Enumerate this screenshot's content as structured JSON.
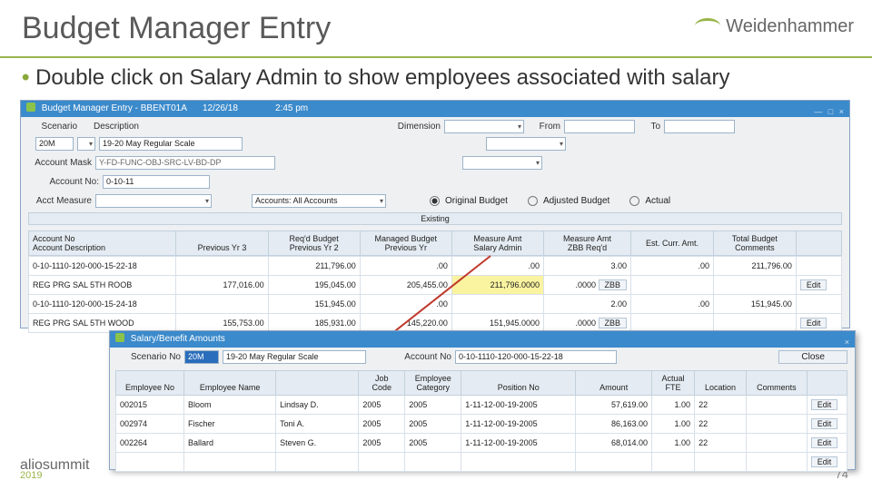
{
  "slide": {
    "title": "Budget Manager Entry",
    "bullet": "Double click on Salary Admin to show employees associated with salary",
    "brand": "Weidenhammer",
    "footer_logo": "aliosummit",
    "footer_year": "2019",
    "page_num": "74"
  },
  "win1": {
    "title": "Budget Manager Entry - BBENT01A",
    "date": "12/26/18",
    "time": "2:45 pm",
    "labels": {
      "scenario": "Scenario",
      "description": "Description",
      "dimension": "Dimension",
      "from": "From",
      "to": "To",
      "acct_mask": "Account Mask",
      "acct_no": "Account No:",
      "acct_measure": "Acct Measure"
    },
    "values": {
      "scenario": "20M",
      "description": "19-20 May Regular Scale",
      "acct_mask": "Y-FD-FUNC-OBJ-SRC-LV-BD-DP",
      "acct_no": "0-10-11"
    },
    "accounts_filter": "Accounts: All Accounts",
    "radios": {
      "orig": "Original Budget",
      "adj": "Adjusted Budget",
      "act": "Actual"
    },
    "existing_header": "Existing",
    "cols": {
      "acct_no": "Account No",
      "acct_desc": "Account Description",
      "py3": "Previous Yr 3",
      "reqd": "Req'd Budget",
      "py2": "Previous Yr 2",
      "managed": "Managed Budget",
      "py": "Previous Yr",
      "meas_amt_top": "Measure Amt",
      "sal_admin": "Salary Admin",
      "meas_amt2": "Measure Amt",
      "zbb": "ZBB Req'd",
      "est": "Est. Curr. Amt.",
      "total": "Total Budget",
      "comments": "Comments"
    },
    "rows": [
      {
        "acct_no": "0-10-1110-120-000-15-22-18",
        "reqd": "211,796.00",
        "managed": ".00",
        "sal_admin": ".00",
        "zbb": "3.00",
        "est": ".00",
        "total": "211,796.00",
        "desc": "REG PRG SAL 5TH ROOB",
        "py3": "177,016.00",
        "py2": "195,045.00",
        "py": "205,455.00",
        "sal_admin2": "211,796.0000",
        "zbb2": ".0000",
        "zbbcode": "ZBB",
        "edit": "Edit"
      },
      {
        "acct_no": "0-10-1110-120-000-15-24-18",
        "reqd": "151,945.00",
        "managed": ".00",
        "sal_admin": "",
        "zbb": "2.00",
        "est": ".00",
        "total": "151,945.00",
        "desc": "REG PRG SAL 5TH WOOD",
        "py3": "155,753.00",
        "py2": "185,931.00",
        "py": "145,220.00",
        "sal_admin2": "151,945.0000",
        "zbb2": ".0000",
        "zbbcode": "ZBB",
        "edit": "Edit"
      }
    ]
  },
  "win2": {
    "title": "Salary/Benefit Amounts",
    "labels": {
      "scenario_no": "Scenario No",
      "acct_no": "Account No"
    },
    "values": {
      "scenario_no": "20M",
      "scenario_desc": "19-20 May Regular Scale",
      "acct_no": "0-10-1110-120-000-15-22-18"
    },
    "close": "Close",
    "cols": {
      "emp_no": "Employee No",
      "emp_name": "Employee Name",
      "job_code_top": "Job",
      "job_code": "Code",
      "emp_cat_top": "Employee",
      "emp_cat": "Category",
      "pos": "Position No",
      "amount": "Amount",
      "fte_top": "Actual",
      "fte": "FTE",
      "loc": "Location",
      "comments": "Comments"
    },
    "rows": [
      {
        "no": "002015",
        "name": "Bloom",
        "first": "Lindsay D.",
        "job": "2005",
        "cat": "2005",
        "pos": "1-11-12-00-19-2005",
        "amt": "57,619.00",
        "fte": "1.00",
        "loc": "22",
        "edit": "Edit"
      },
      {
        "no": "002974",
        "name": "Fischer",
        "first": "Toni A.",
        "job": "2005",
        "cat": "2005",
        "pos": "1-11-12-00-19-2005",
        "amt": "86,163.00",
        "fte": "1.00",
        "loc": "22",
        "edit": "Edit"
      },
      {
        "no": "002264",
        "name": "Ballard",
        "first": "Steven G.",
        "job": "2005",
        "cat": "2005",
        "pos": "1-11-12-00-19-2005",
        "amt": "68,014.00",
        "fte": "1.00",
        "loc": "22",
        "edit": "Edit"
      }
    ],
    "last_edit": "Edit"
  }
}
